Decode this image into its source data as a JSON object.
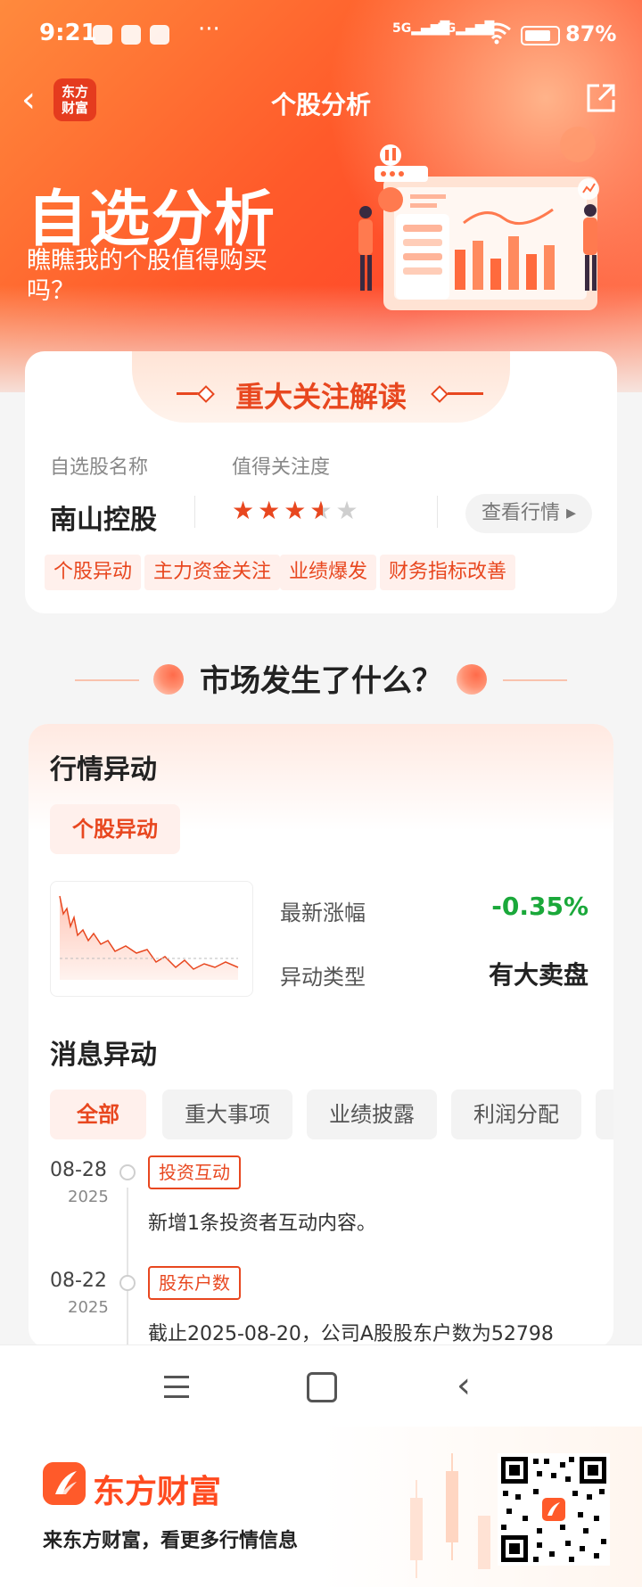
{
  "status_bar": {
    "time": "9:21",
    "battery": "87%",
    "signal1": "5G",
    "signal2": "5G"
  },
  "nav": {
    "logo_text": "东方财富",
    "title": "个股分析"
  },
  "hero": {
    "title": "自选分析",
    "subtitle": "瞧瞧我的个股值得购买吗？"
  },
  "focus_card": {
    "title": "重大关注解读",
    "stock_label": "自选股名称",
    "attention_label": "值得关注度",
    "stock_name": "南山控股",
    "rating": 3.5,
    "rating_max": 5,
    "quote_button": "查看行情",
    "tags": [
      "个股异动",
      "主力资金关注",
      "业绩爆发",
      "财务指标改善"
    ]
  },
  "section": {
    "title": "市场发生了什么？"
  },
  "market_card": {
    "quote_heading": "行情异动",
    "quote_tab": "个股异动",
    "latest_change_label": "最新涨幅",
    "latest_change_value": "-0.35%",
    "anomaly_type_label": "异动类型",
    "anomaly_type_value": "有大卖盘",
    "news_heading": "消息异动",
    "news_tabs": [
      "全部",
      "重大事项",
      "业绩披露",
      "利润分配"
    ],
    "news": [
      {
        "date": "08-28",
        "year": "2025",
        "tag": "投资互动",
        "text": "新增1条投资者互动内容。"
      },
      {
        "date": "08-22",
        "year": "2025",
        "tag": "股东户数",
        "text": "截止2025-08-20，公司A股股东户数为52798"
      }
    ]
  },
  "footer": {
    "brand": "东方财富",
    "slogan": "来东方财富，看更多行情信息"
  },
  "colors": {
    "accent": "#e8471f",
    "down": "#1aa83a",
    "hero": "#ff5a2a"
  }
}
